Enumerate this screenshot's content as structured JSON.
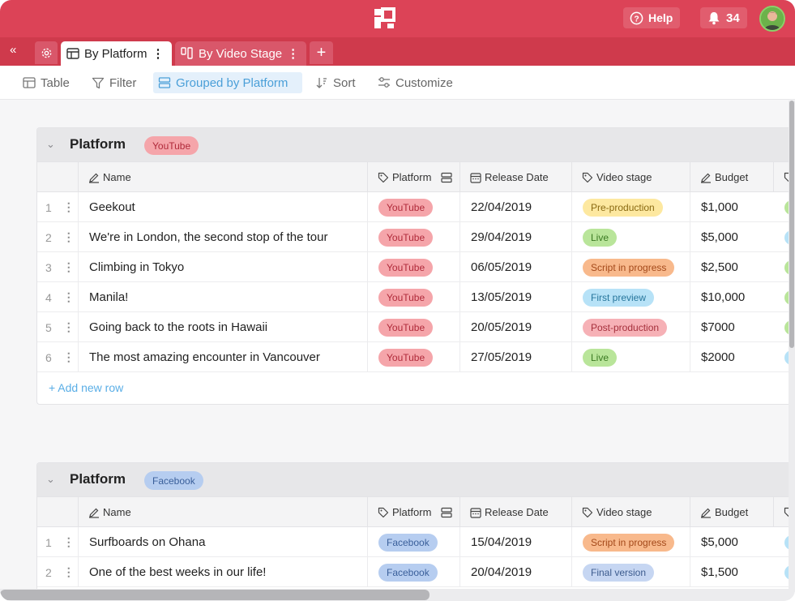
{
  "header": {
    "help_label": "Help",
    "notifications_count": "34"
  },
  "tabs": {
    "active_label": "By Platform",
    "inactive_label": "By Video Stage",
    "add_label": "+"
  },
  "toolbar": {
    "table_label": "Table",
    "filter_label": "Filter",
    "group_label": "Grouped by Platform",
    "sort_label": "Sort",
    "customize_label": "Customize"
  },
  "columns": {
    "name": "Name",
    "platform": "Platform",
    "release": "Release Date",
    "stage": "Video stage",
    "budget": "Budget"
  },
  "groups": [
    {
      "title": "Platform",
      "badge": "YouTube",
      "add_row_label": "+ Add new row",
      "rows": [
        {
          "num": "1",
          "name": "Geekout",
          "platform": "YouTube",
          "release": "22/04/2019",
          "stage": "Pre-production",
          "budget": "$1,000"
        },
        {
          "num": "2",
          "name": "We're in London, the second stop of the tour",
          "platform": "YouTube",
          "release": "29/04/2019",
          "stage": "Live",
          "budget": "$5,000"
        },
        {
          "num": "3",
          "name": "Climbing in Tokyo",
          "platform": "YouTube",
          "release": "06/05/2019",
          "stage": "Script in progress",
          "budget": "$2,500"
        },
        {
          "num": "4",
          "name": "Manila!",
          "platform": "YouTube",
          "release": "13/05/2019",
          "stage": "First preview",
          "budget": "$10,000"
        },
        {
          "num": "5",
          "name": "Going back to the roots in Hawaii",
          "platform": "YouTube",
          "release": "20/05/2019",
          "stage": "Post-production",
          "budget": "$7000"
        },
        {
          "num": "6",
          "name": "The most amazing encounter in Vancouver",
          "platform": "YouTube",
          "release": "27/05/2019",
          "stage": "Live",
          "budget": "$2000"
        }
      ]
    },
    {
      "title": "Platform",
      "badge": "Facebook",
      "rows": [
        {
          "num": "1",
          "name": "Surfboards on Ohana",
          "platform": "Facebook",
          "release": "15/04/2019",
          "stage": "Script in progress",
          "budget": "$5,000"
        },
        {
          "num": "2",
          "name": "One of the best weeks in our life!",
          "platform": "Facebook",
          "release": "20/04/2019",
          "stage": "Final version",
          "budget": "$1,500"
        }
      ]
    }
  ],
  "colors": {
    "brand": "#dc4357",
    "tabbar": "#cf3a4c",
    "accent": "#4a9fd8"
  }
}
